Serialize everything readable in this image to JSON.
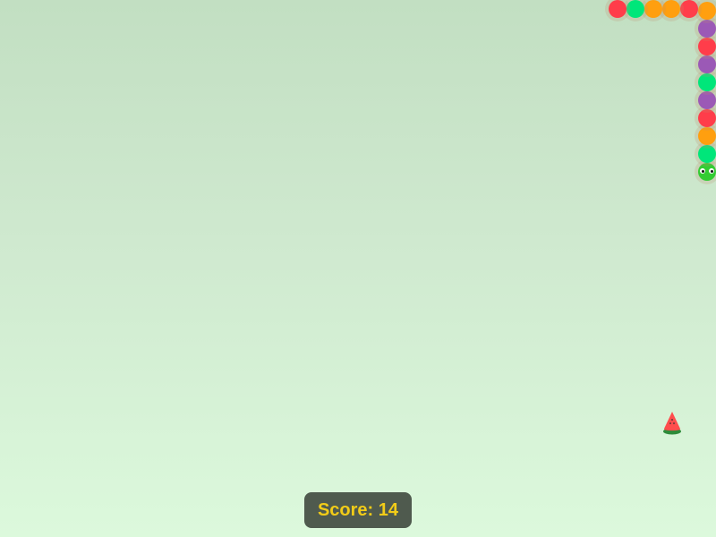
{
  "score": {
    "label": "Score:",
    "value": "14"
  },
  "snake": {
    "direction": "down",
    "segments": [
      {
        "kind": "head",
        "color": "#33cc33"
      },
      {
        "kind": "body",
        "color": "#00e67a"
      },
      {
        "kind": "body",
        "color": "#ff9f0f"
      },
      {
        "kind": "body",
        "color": "#ff3d4a"
      },
      {
        "kind": "body",
        "color": "#9b59b6"
      },
      {
        "kind": "body",
        "color": "#00e67a"
      },
      {
        "kind": "body",
        "color": "#9b59b6"
      },
      {
        "kind": "body",
        "color": "#ff3d4a"
      },
      {
        "kind": "body",
        "color": "#9b59b6"
      },
      {
        "kind": "body",
        "color": "#ff9f0f"
      },
      {
        "kind": "body",
        "color": "#ff3d4a"
      },
      {
        "kind": "body",
        "color": "#ff9f0f"
      },
      {
        "kind": "body",
        "color": "#ff9f0f"
      },
      {
        "kind": "body",
        "color": "#00e67a"
      },
      {
        "kind": "body",
        "color": "#ff3d4a"
      }
    ]
  },
  "fruits": [
    {
      "type": "watermelon-slice",
      "icon": "watermelon-icon",
      "flesh_color": "#ff4d4d",
      "rind_color": "#2e8b3a"
    }
  ],
  "colors": {
    "background_top": "#c2dfc2",
    "background_bottom": "#dcf9dc",
    "score_panel": "#4f5a4e",
    "score_text": "#f2cc18"
  }
}
